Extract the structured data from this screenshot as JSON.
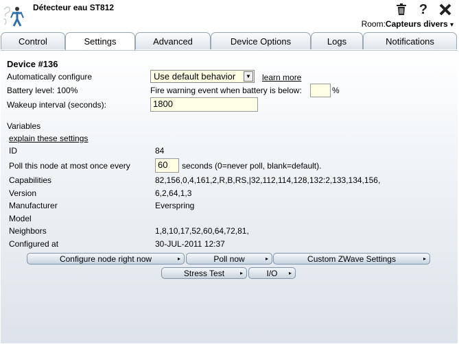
{
  "header": {
    "title": "Détecteur eau ST812",
    "icons": [
      "trash-icon",
      "help-icon",
      "close-icon"
    ],
    "help_glyph": "?",
    "room_label": "Room:",
    "room_value": "Capteurs divers",
    "room_arrow": "▾"
  },
  "tabs": [
    {
      "label": "Control"
    },
    {
      "label": "Settings"
    },
    {
      "label": "Advanced"
    },
    {
      "label": "Device Options"
    },
    {
      "label": "Logs"
    },
    {
      "label": "Notifications"
    }
  ],
  "active_tab": "Settings",
  "settings": {
    "device_label": "Device #136",
    "auto_configure_label": "Automatically configure",
    "auto_configure_value": "Use default behavior",
    "learn_more": "learn more",
    "battery_level": "Battery level: 100%",
    "fire_warning_label": "Fire warning event when battery is below:",
    "fire_warning_value": "",
    "percent": "%",
    "wakeup_label": "Wakeup interval (seconds):",
    "wakeup_value": "1800"
  },
  "variables": {
    "title": "Variables",
    "explain": "explain these settings",
    "id_label": "ID",
    "id_value": "84",
    "poll_label": "Poll this node at most once every",
    "poll_value": "60",
    "poll_suffix": "seconds (0=never poll, blank=default).",
    "capabilities_label": "Capabilities",
    "capabilities_value": "82,156,0,4,161,2,R,B,RS,|32,112,114,128,132:2,133,134,156,",
    "version_label": "Version",
    "version_value": "6,2,64,1,3",
    "manufacturer_label": "Manufacturer",
    "manufacturer_value": "Everspring",
    "model_label": "Model",
    "model_value": "",
    "neighbors_label": "Neighbors",
    "neighbors_value": "1,8,10,17,52,60,64,72,81,",
    "configured_label": "Configured at",
    "configured_value": "30-JUL-2011 12:37"
  },
  "buttons": {
    "configure": "Configure node right now",
    "poll": "Poll now",
    "custom": "Custom ZWave Settings",
    "stress": "Stress Test",
    "io": "I/O",
    "arrow": "▸"
  },
  "colors": {
    "input_bg": "#ffffe6",
    "tab_border": "#9aa6b2",
    "button_border": "#7f93aa"
  }
}
